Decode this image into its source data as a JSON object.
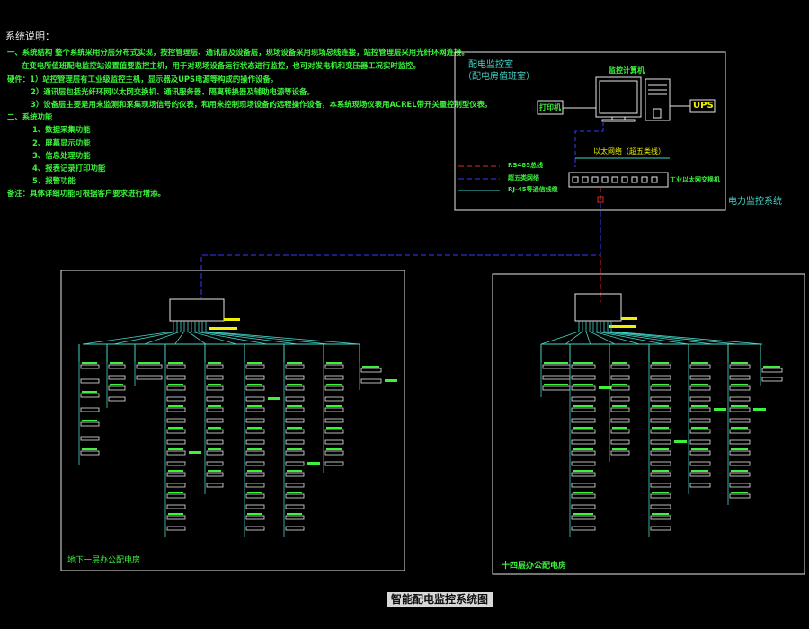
{
  "notes": {
    "heading": "系统说明：",
    "lines": [
      "一、系统结构 整个系统采用分层分布式实现，按控管理层、通讯层及设备层，现场设备采用现场总线连接，站控管理层采用光纤环网连接。",
      "在变电所值班配电监控站设置值要监控主机，用于对现场设备运行状态进行监控，也可对发电机和变压器工况实时监控。",
      "硬件：1）站控管理层有工业级监控主机，显示器及UPS电源等构成的操作设备。",
      "2）通讯层包括光纤环网以太网交换机、通讯服务器、隔离转换器及辅助电源等设备。",
      "3）设备层主要是用来监测和采集现场信号的仪表，和用来控制现场设备的远程操作设备，本系统现场仪表用ACREL带开关量控制型仪表。",
      "二、系统功能",
      "1、数据采集功能",
      "2、屏幕显示功能",
      "3、信息处理功能",
      "4、报表记录打印功能",
      "5、报警功能",
      "备注：具体详细功能可根据客户要求进行增添。"
    ]
  },
  "control_room": {
    "title": "配电监控室",
    "subtitle": "（配电房值班室）",
    "computer": "监控计算机",
    "printer": "打印机",
    "ups": "UPS",
    "ethernet": "以太网络（超五类线）",
    "switch": "工业以太网交换机",
    "legend": [
      "RS485总线",
      "超五类网络",
      "RJ-45等通信线缆"
    ],
    "system_label": "电力监控系统"
  },
  "rooms": [
    {
      "name": "地下一层办公配电房"
    },
    {
      "name": "十四层办公配电房"
    }
  ],
  "diagram_title": "智能配电监控系统图",
  "colors": {
    "rs485": "#d62a2a",
    "ethernet": "#3a3aff",
    "cable": "#45d4c8",
    "text_green": "#3cf23c",
    "frame": "#e6e6e6"
  }
}
